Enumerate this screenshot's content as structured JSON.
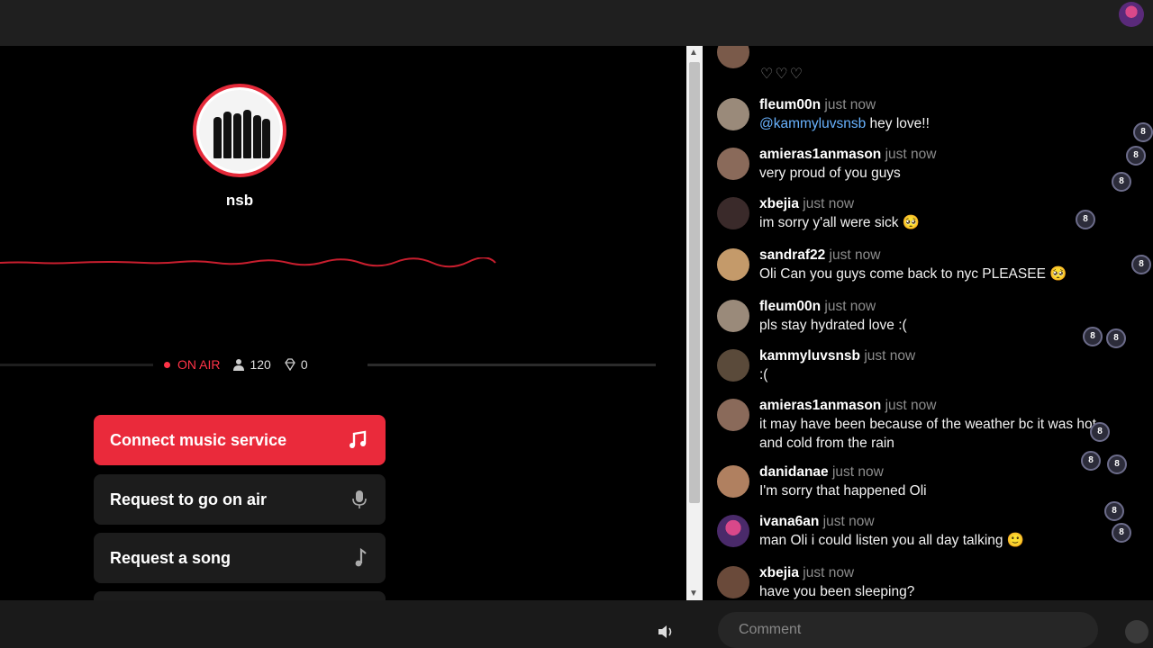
{
  "colors": {
    "accent": "#ea2a3b",
    "mention": "#69b3ff",
    "background": "#000000"
  },
  "station": {
    "name": "nsb",
    "on_air_label": "ON AIR",
    "listeners": "120",
    "diamonds": "0"
  },
  "actions": {
    "connect_music": "Connect music service",
    "request_on_air": "Request to go on air",
    "request_song": "Request a song"
  },
  "icons": {
    "music": "music-note-icon",
    "mic": "microphone-icon",
    "note": "note-icon",
    "volume": "speaker-icon",
    "gift": "coin-icon"
  },
  "chat": {
    "partial_hearts": "♡♡♡",
    "messages": [
      {
        "user": "fleum00n",
        "time": "just now",
        "mention": "@kammyluvsnsb",
        "text": " hey love!!"
      },
      {
        "user": "amieras1anmason",
        "time": "just now",
        "text": "very proud of you guys"
      },
      {
        "user": "xbejia",
        "time": "just now",
        "text": "im sorry y'all were sick 🥺"
      },
      {
        "user": "sandraf22",
        "time": "just now",
        "text": "Oli Can you guys come back to nyc PLEASEE 🥺"
      },
      {
        "user": "fleum00n",
        "time": "just now",
        "text": "pls stay hydrated love :("
      },
      {
        "user": "kammyluvsnsb",
        "time": "just now",
        "text": ":("
      },
      {
        "user": "amieras1anmason",
        "time": "just now",
        "text": "it may have been because of the weather bc it was hot",
        "text2": "and cold from the rain"
      },
      {
        "user": "danidanae",
        "time": "just now",
        "text": "I'm sorry that happened Oli"
      },
      {
        "user": "ivana6an",
        "time": "just now",
        "text": "man Oli i could listen you all day talking 🙂"
      },
      {
        "user": "xbejia",
        "time": "just now",
        "text": "have you been sleeping?"
      }
    ]
  },
  "comment": {
    "placeholder": "Comment"
  }
}
